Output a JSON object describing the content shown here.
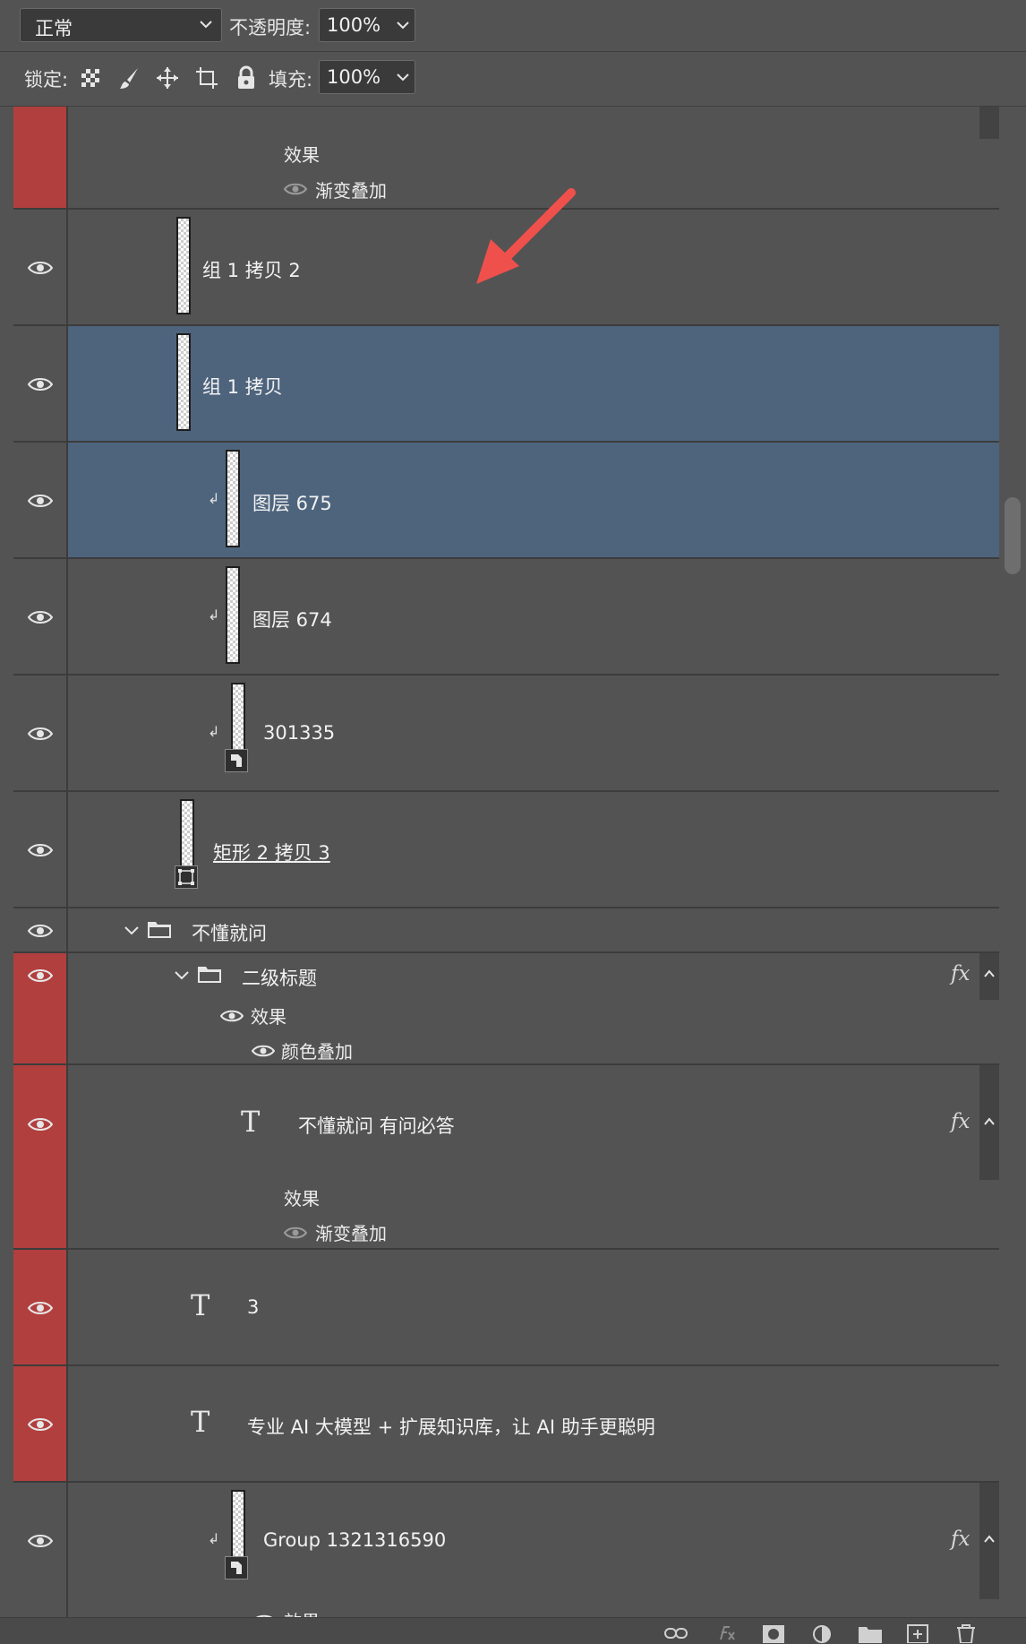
{
  "blend_mode": {
    "value": "正常"
  },
  "opacity": {
    "label": "不透明度:",
    "value": "100%"
  },
  "lock": {
    "label": "锁定:"
  },
  "fill": {
    "label": "填充:",
    "value": "100%"
  },
  "layers": [
    {
      "id": "top-effect",
      "effects_label": "效果",
      "effect": "渐变叠加"
    },
    {
      "id": "group1-copy2",
      "name": "组 1 拷贝 2"
    },
    {
      "id": "group1-copy",
      "name": "组 1 拷贝"
    },
    {
      "id": "layer675",
      "name": "图层 675"
    },
    {
      "id": "layer674",
      "name": "图层 674"
    },
    {
      "id": "l301335",
      "name": "301335"
    },
    {
      "id": "rect2copy3",
      "name": "矩形 2 拷贝 3"
    },
    {
      "id": "group-budong",
      "name": "不懂就问"
    },
    {
      "id": "group-erji",
      "name": "二级标题",
      "effects_label": "效果",
      "effect": "颜色叠加",
      "fx": "fx"
    },
    {
      "id": "text-budong",
      "name": "不懂就问 有问必答",
      "effects_label": "效果",
      "effect": "渐变叠加",
      "fx": "fx"
    },
    {
      "id": "text-3",
      "name": "3"
    },
    {
      "id": "text-pro",
      "name": "专业 AI 大模型 + 扩展知识库，让 AI 助手更聪明"
    },
    {
      "id": "group-1321316590",
      "name": "Group 1321316590",
      "effects_label": "效果",
      "fx": "fx"
    }
  ],
  "colors": {
    "selected": "#4e647d",
    "red_tag": "#b13f3e",
    "panel": "#535353",
    "annotation_arrow": "#f0504b"
  },
  "bottom_icons": [
    "link-icon",
    "fx-icon",
    "mask-icon",
    "adjustment-icon",
    "folder-icon",
    "new-layer-icon",
    "trash-icon"
  ]
}
